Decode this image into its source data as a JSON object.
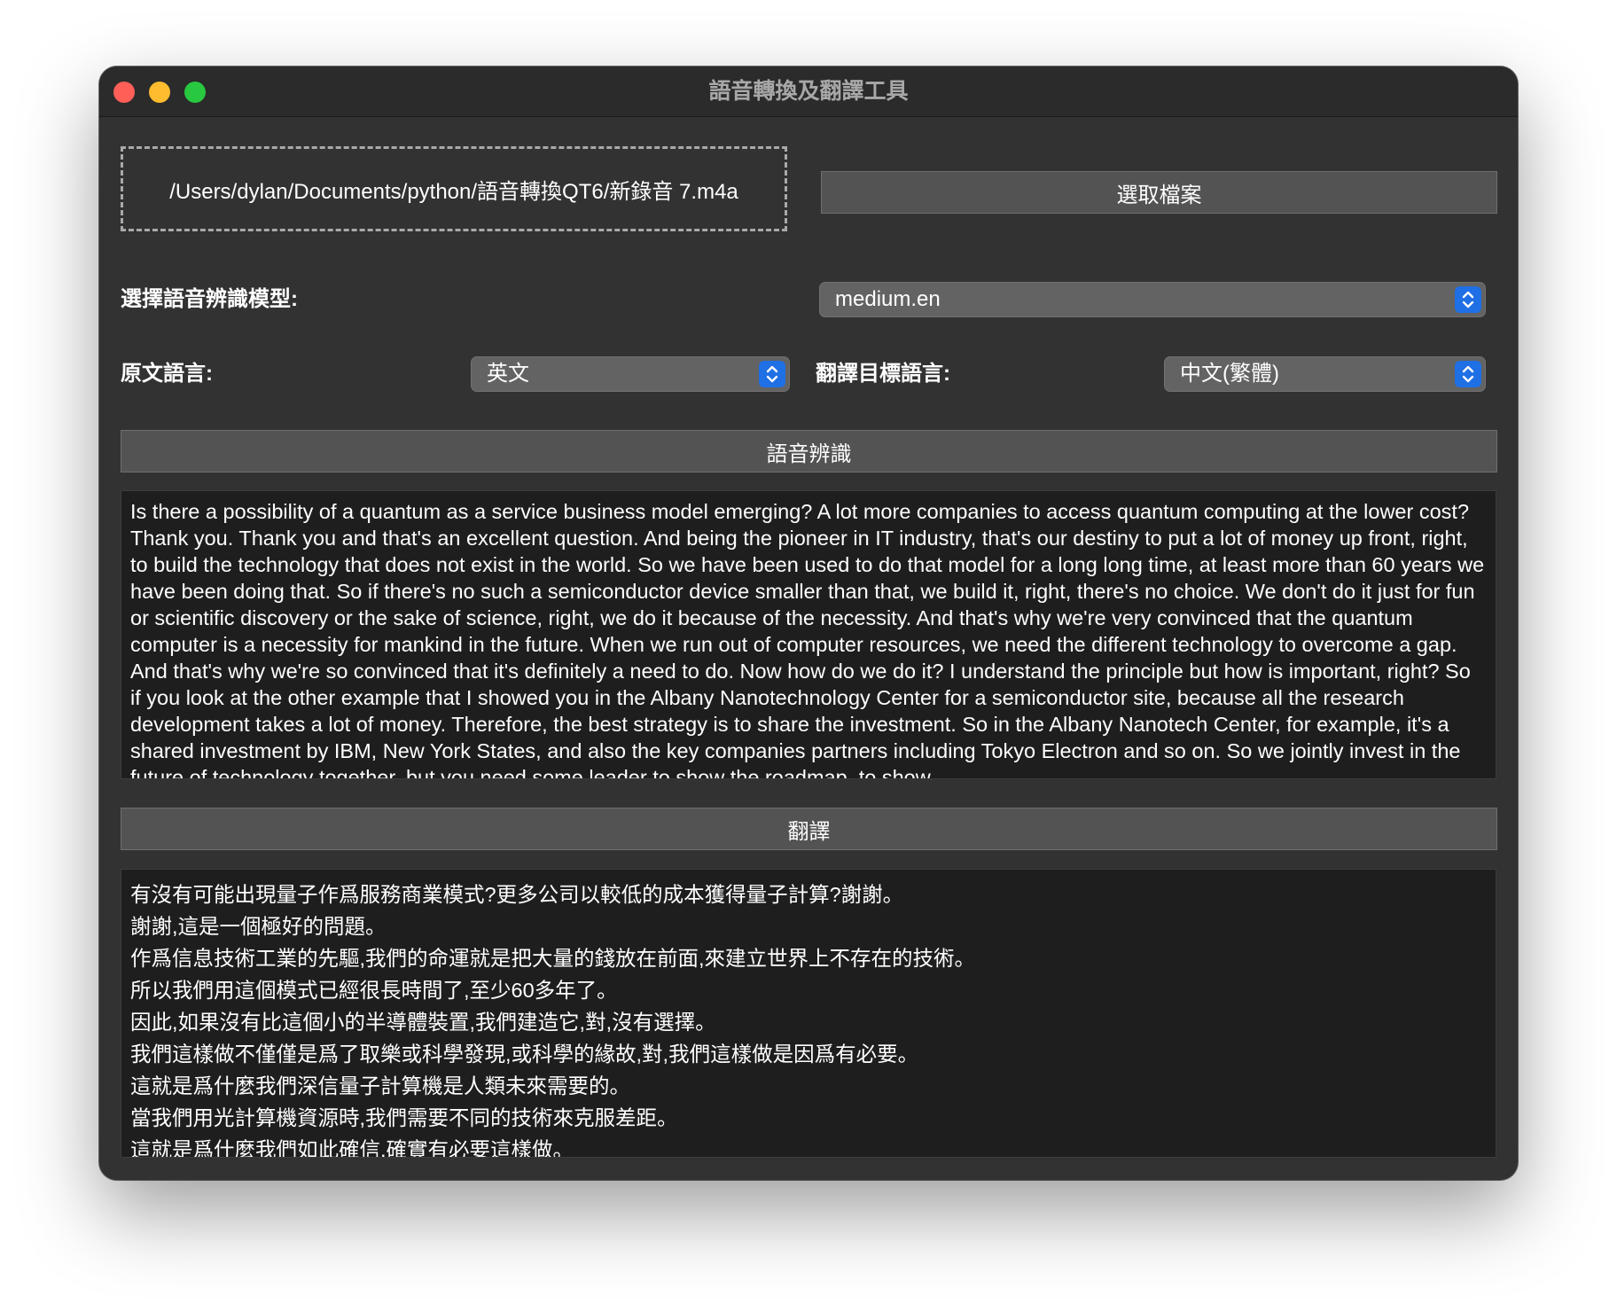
{
  "window": {
    "title": "語音轉換及翻譯工具"
  },
  "file": {
    "path": "/Users/dylan/Documents/python/語音轉換QT6/新錄音 7.m4a",
    "select_button": "選取檔案"
  },
  "model": {
    "label": "選擇語音辨識模型:",
    "selected": "medium.en"
  },
  "source_language": {
    "label": "原文語言:",
    "selected": "英文"
  },
  "target_language": {
    "label": "翻譯目標語言:",
    "selected": "中文(繁體)"
  },
  "recognize_button": "語音辨識",
  "transcript": " Is there a possibility of a quantum as a service business model emerging? A lot more companies to access quantum computing at the lower cost? Thank you. Thank you and that's an excellent question. And being the pioneer in IT industry, that's our destiny to put a lot of money up front, right, to build the technology that does not exist in the world. So we have been used to do that model for a long long time, at least more than 60 years we have been doing that. So if there's no such a semiconductor device smaller than that, we build it, right, there's no choice. We don't do it just for fun or scientific discovery or the sake of science, right, we do it because of the necessity. And that's why we're very convinced that the quantum computer is a necessity for mankind in the future. When we run out of computer resources, we need the different technology to overcome a gap. And that's why we're so convinced that it's definitely a need to do. Now how do we do it? I understand the principle but how is important, right? So if you look at the other example that I showed you in the Albany Nanotechnology Center for a semiconductor site, because all the research development takes a lot of money. Therefore, the best strategy is to share the investment. So in the Albany Nanotech Center, for example, it's a shared investment by IBM, New York States, and also the key companies partners including Tokyo Electron and so on. So we jointly invest in the future of technology together, but you need some leader to show the roadmap, to show",
  "translate_button": "翻譯",
  "translation_lines": [
    "有沒有可能出現量子作爲服務商業模式?更多公司以較低的成本獲得量子計算?謝謝。",
    "謝謝,這是一個極好的問題。",
    "作爲信息技術工業的先驅,我們的命運就是把大量的錢放在前面,來建立世界上不存在的技術。",
    "所以我們用這個模式已經很長時間了,至少60多年了。",
    "因此,如果沒有比這個小的半導體裝置,我們建造它,對,沒有選擇。",
    "我們這樣做不僅僅是爲了取樂或科學發現,或科學的緣故,對,我們這樣做是因爲有必要。",
    "這就是爲什麼我們深信量子計算機是人類未來需要的。",
    "當我們用光計算機資源時,我們需要不同的技術來克服差距。",
    "這就是爲什麼我們如此確信,確實有必要這樣做。"
  ],
  "colors": {
    "window_bg": "#323232",
    "titlebar_bg": "#2b2b2b",
    "button_bg": "#535353",
    "select_bg": "#636363",
    "text_area_bg": "#1e1e1e",
    "select_chevron": "#1f6fe5",
    "close": "#ff5f57",
    "minimize": "#febc2e",
    "maximize": "#28c840"
  },
  "icons": {
    "window_controls": [
      "close-icon",
      "minimize-icon",
      "maximize-icon"
    ],
    "select_indicator": "chevron-updown-icon"
  }
}
